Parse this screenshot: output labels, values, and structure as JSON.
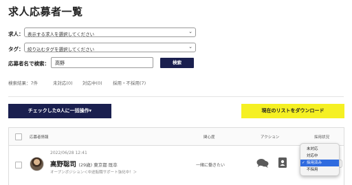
{
  "page": {
    "title": "求人応募者一覧"
  },
  "filters": {
    "job_label": "求人：",
    "job_placeholder": "表示する求人を選択してください",
    "tag_label": "タグ：",
    "tag_placeholder": "絞り込むタグを選択してください"
  },
  "search": {
    "label": "応募者名で検索：",
    "value": "高野",
    "button_label": "検索"
  },
  "status_tabs": [
    {
      "label": "検索結果：7件"
    },
    {
      "label": "未対応(0)"
    },
    {
      "label": "対応中(0)"
    },
    {
      "label": "採用・不採用(7)"
    }
  ],
  "actions": {
    "bulk_label": "チェックした0人に一括操作▾",
    "download_label": "現在のリストをダウンロード"
  },
  "table": {
    "headers": {
      "applicant": "応募者情報",
      "interest": "関心度",
      "action": "アクション",
      "status": "採用状況"
    },
    "rows": [
      {
        "date": "2022/06/28 12:41",
        "name": "高野聡司",
        "meta": "(29歳) 東京都 既卒",
        "position": "オープンポジション＜中途転職サポート強化中！＞",
        "interest": "一緒に働きたい"
      }
    ]
  },
  "status_dropdown": {
    "options": [
      {
        "label": "未対応"
      },
      {
        "label": "対応中"
      },
      {
        "label": "採用済み"
      },
      {
        "label": "不採用"
      }
    ],
    "selected": "採用済み"
  },
  "colors": {
    "primary_navy": "#1a1f4f",
    "download_yellow": "#f5f023",
    "selected_blue": "#2f6bdf"
  },
  "icons": [
    "chevron-down-icon",
    "chat-bubbles-icon",
    "profile-card-icon",
    "check-icon"
  ]
}
